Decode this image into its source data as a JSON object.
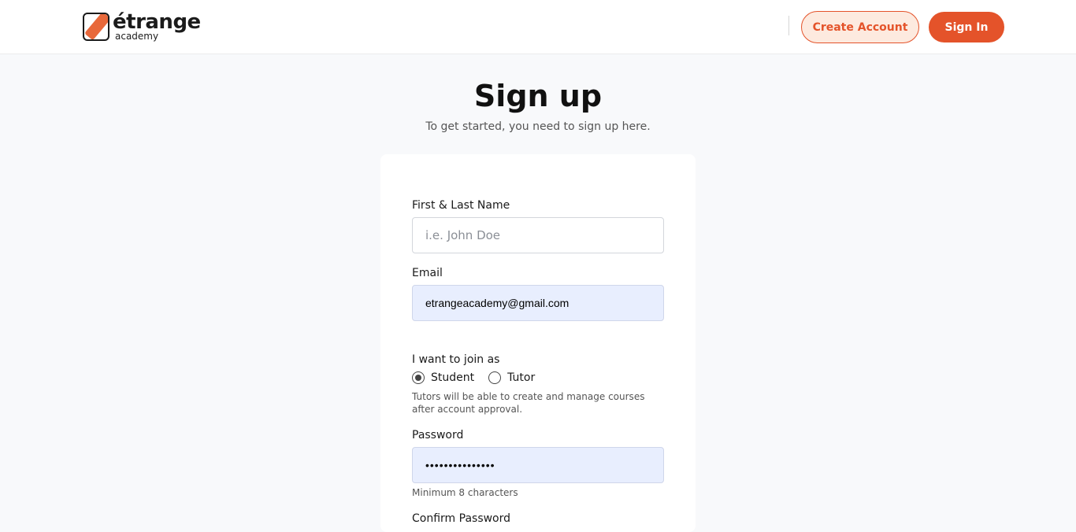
{
  "header": {
    "logo_word": "étrange",
    "logo_sub": "academy",
    "create_account_label": "Create Account",
    "sign_in_label": "Sign In"
  },
  "page": {
    "title": "Sign up",
    "subtitle": "To get started, you need to sign up here."
  },
  "form": {
    "name": {
      "label": "First & Last Name",
      "placeholder": "i.e. John Doe",
      "value": ""
    },
    "email": {
      "label": "Email",
      "value": "etrangeacademy@gmail.com"
    },
    "join_as": {
      "label": "I want to join as",
      "options": [
        {
          "label": "Student",
          "selected": true
        },
        {
          "label": "Tutor",
          "selected": false
        }
      ],
      "hint": "Tutors will be able to create and manage courses after account approval."
    },
    "password": {
      "label": "Password",
      "value": "•••••••••••••••",
      "hint": "Minimum 8 characters"
    },
    "confirm_password": {
      "label": "Confirm Password"
    }
  },
  "colors": {
    "accent": "#e4532a",
    "accent_light": "#fdeadf",
    "autofill_bg": "#e8eefe",
    "page_bg": "#f8f9fb"
  }
}
